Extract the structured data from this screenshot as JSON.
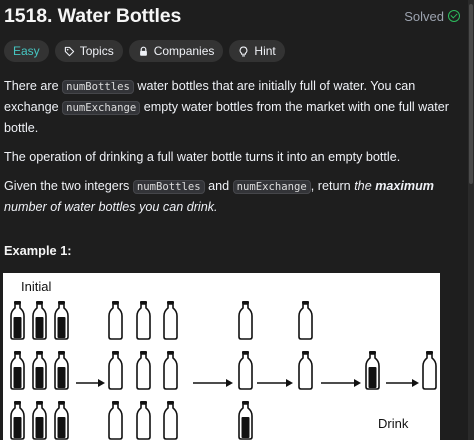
{
  "problem": {
    "title": "1518. Water Bottles",
    "status": "Solved"
  },
  "tags": {
    "difficulty": "Easy",
    "topics": "Topics",
    "companies": "Companies",
    "hint": "Hint"
  },
  "description": {
    "p1_a": "There are ",
    "p1_code1": "numBottles",
    "p1_b": " water bottles that are initially full of water. You can exchange ",
    "p1_code2": "numExchange",
    "p1_c": " empty water bottles from the market with one full water bottle.",
    "p2": "The operation of drinking a full water bottle turns it into an empty bottle.",
    "p3_a": "Given the two integers ",
    "p3_code1": "numBottles",
    "p3_b": " and ",
    "p3_code2": "numExchange",
    "p3_c": ", return ",
    "p3_the": "the ",
    "p3_max": "maximum",
    "p3_d": " number of water bottles you can drink."
  },
  "example": {
    "title": "Example 1:",
    "figure_label_initial": "Initial",
    "figure_label_drink": "Drink"
  },
  "icons": {
    "solved": "check-circle-icon",
    "topics": "tag-icon",
    "companies": "lock-icon",
    "hint": "lightbulb-icon"
  },
  "colors": {
    "easy": "#46c6c2",
    "solved": "#2cbb5d",
    "background": "#1e1e1e",
    "tag_bg": "#333333"
  }
}
